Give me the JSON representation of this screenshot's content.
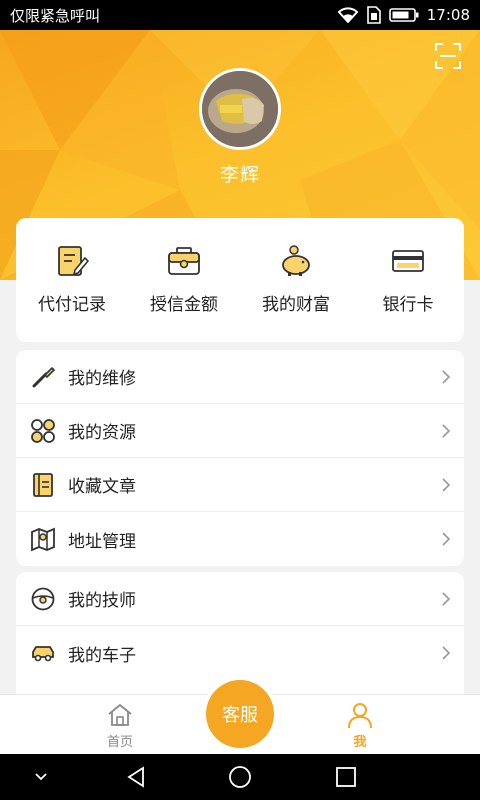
{
  "status_bar": {
    "carrier_text": "仅限紧急呼叫",
    "time": "17:08",
    "icons": [
      "wifi-icon",
      "sim-icon",
      "battery-icon"
    ]
  },
  "header": {
    "username": "李辉",
    "scan_icon": "scan-icon",
    "accent_color": "#f5a623"
  },
  "quick_actions": [
    {
      "label": "代付记录",
      "icon": "payment-record-icon"
    },
    {
      "label": "授信金额",
      "icon": "credit-wallet-icon"
    },
    {
      "label": "我的财富",
      "icon": "piggy-bank-icon"
    },
    {
      "label": "银行卡",
      "icon": "bank-card-icon"
    }
  ],
  "menu_group_1": [
    {
      "label": "我的维修",
      "icon": "repair-tool-icon"
    },
    {
      "label": "我的资源",
      "icon": "resources-icon"
    },
    {
      "label": "收藏文章",
      "icon": "bookmark-article-icon"
    },
    {
      "label": "地址管理",
      "icon": "map-address-icon"
    }
  ],
  "menu_group_2": [
    {
      "label": "我的技师",
      "icon": "technician-wheel-icon"
    },
    {
      "label": "我的车子",
      "icon": "car-icon"
    }
  ],
  "tab_bar": {
    "home_label": "首页",
    "service_label": "客服",
    "me_label": "我",
    "active_tab": "me"
  },
  "nav_bar": {
    "icons": [
      "collapse-icon",
      "back-icon",
      "home-circle-icon",
      "recents-icon"
    ]
  }
}
